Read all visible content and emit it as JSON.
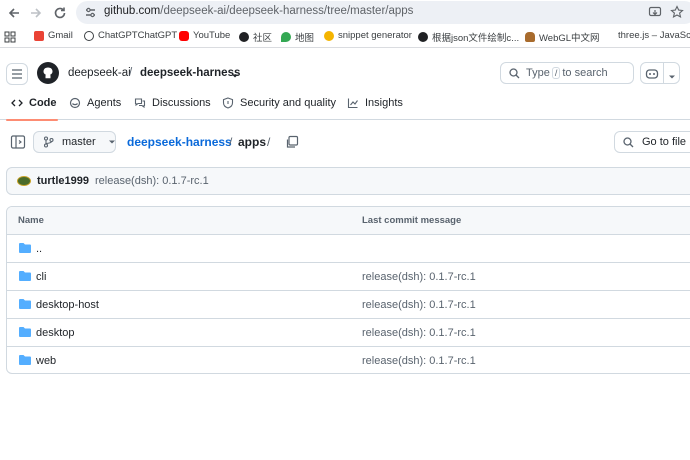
{
  "browser": {
    "url_host": "github.com",
    "url_path": "/deepseek-ai/deepseek-harness/tree/master/apps",
    "bookmarks": [
      {
        "label": "Gmail",
        "color": "#ea4335"
      },
      {
        "label": "ChatGPTChatGPT",
        "color": "#3c4043"
      },
      {
        "label": "YouTube",
        "color": "#ff0000"
      },
      {
        "label": "社区",
        "color": "#202124"
      },
      {
        "label": "地图",
        "color": "#34a853"
      },
      {
        "label": "snippet generator",
        "color": "#f4b400"
      },
      {
        "label": "根据json文件绘制c...",
        "color": "#202124"
      },
      {
        "label": "WebGL中文网",
        "color": "#a86b2d"
      },
      {
        "label": "three.js – JavaScri",
        "color": "#ffffff"
      }
    ]
  },
  "header": {
    "owner": "deepseek-ai",
    "separator": "/",
    "repo": "deepseek-harness",
    "search_prefix": "Type",
    "search_key": "/",
    "search_suffix": "to search"
  },
  "tabs": [
    {
      "label": "Code",
      "icon": "code-icon",
      "active": true
    },
    {
      "label": "Agents",
      "icon": "agents-icon"
    },
    {
      "label": "Discussions",
      "icon": "discussions-icon"
    },
    {
      "label": "Security and quality",
      "icon": "shield-icon"
    },
    {
      "label": "Insights",
      "icon": "graph-icon"
    }
  ],
  "pathbar": {
    "branch": "master",
    "repo": "deepseek-harness",
    "sep": "/",
    "dir": "apps",
    "goto_label": "Go to file"
  },
  "commit": {
    "author": "turtle1999",
    "message": "release(dsh): 0.1.7-rc.1"
  },
  "table": {
    "col_name": "Name",
    "col_msg": "Last commit message",
    "rows": [
      {
        "name": "..",
        "msg": ""
      },
      {
        "name": "cli",
        "msg": "release(dsh): 0.1.7-rc.1"
      },
      {
        "name": "desktop-host",
        "msg": "release(dsh): 0.1.7-rc.1"
      },
      {
        "name": "desktop",
        "msg": "release(dsh): 0.1.7-rc.1"
      },
      {
        "name": "web",
        "msg": "release(dsh): 0.1.7-rc.1"
      }
    ]
  },
  "colors": {
    "link": "#0969da",
    "folder": "#54aeff",
    "tab_underline": "#fd8c73"
  }
}
